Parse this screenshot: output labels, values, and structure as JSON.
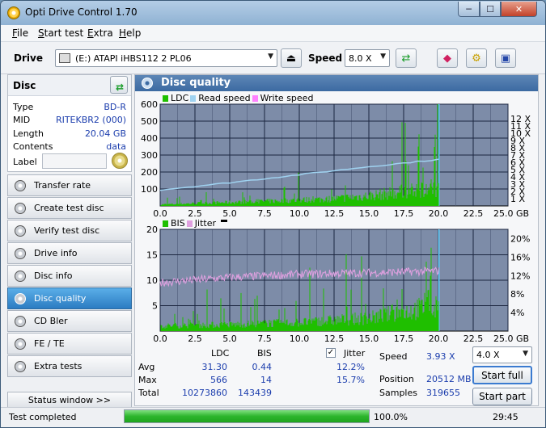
{
  "window": {
    "title": "Opti Drive Control 1.70",
    "min": "─",
    "max": "☐",
    "close": "✕"
  },
  "menu": [
    {
      "key": "F",
      "rest": "ile"
    },
    {
      "key": "S",
      "rest": "tart test"
    },
    {
      "key": "E",
      "rest": "xtra"
    },
    {
      "key": "H",
      "rest": "elp"
    }
  ],
  "toolbar": {
    "drive_label": "Drive",
    "drive_value": "(E:)   ATAPI iHBS112   2 PL06",
    "speed_label": "Speed",
    "speed_value": "8.0 X"
  },
  "disc": {
    "header": "Disc",
    "rows": [
      {
        "label": "Type",
        "value": "BD-R"
      },
      {
        "label": "MID",
        "value": "RITEKBR2 (000)"
      },
      {
        "label": "Length",
        "value": "20.04 GB"
      },
      {
        "label": "Contents",
        "value": "data"
      }
    ],
    "label_field": "Label"
  },
  "nav": [
    {
      "label": "Transfer rate",
      "active": false
    },
    {
      "label": "Create test disc",
      "active": false
    },
    {
      "label": "Verify test disc",
      "active": false
    },
    {
      "label": "Drive info",
      "active": false
    },
    {
      "label": "Disc info",
      "active": false
    },
    {
      "label": "Disc quality",
      "active": true
    },
    {
      "label": "CD Bler",
      "active": false
    },
    {
      "label": "FE / TE",
      "active": false
    },
    {
      "label": "Extra tests",
      "active": false
    }
  ],
  "status_window": "Status window >>",
  "panel_title": "Disc quality",
  "chart_data": [
    {
      "type": "area",
      "legend": [
        "LDC",
        "Read speed",
        "Write speed"
      ],
      "x_ticks": [
        "0.0",
        "2.5",
        "5.0",
        "7.5",
        "10.0",
        "12.5",
        "15.0",
        "17.5",
        "20.0",
        "22.5",
        "25.0 GB"
      ],
      "y_left_ticks": [
        "600",
        "500",
        "400",
        "300",
        "200",
        "100"
      ],
      "y_right_ticks": [
        "12 X",
        "11 X",
        "10 X",
        "9 X",
        "8 X",
        "7 X",
        "6 X",
        "5 X",
        "4 X",
        "3 X",
        "2 X",
        "1 X"
      ],
      "xlim": [
        0,
        25
      ],
      "ylim": [
        0,
        600
      ],
      "data_end": 20.04,
      "ldc_envelope": {
        "x": [
          0,
          2.5,
          5,
          7.5,
          10,
          12.5,
          15,
          17.5,
          20
        ],
        "y": [
          10,
          18,
          25,
          32,
          40,
          50,
          70,
          100,
          130
        ]
      },
      "read_speed": {
        "x": [
          0,
          5,
          10,
          15,
          20
        ],
        "y": [
          2.2,
          3.2,
          4.3,
          5.4,
          6.4
        ]
      }
    },
    {
      "type": "area",
      "legend": [
        "BIS",
        "Jitter"
      ],
      "x_ticks": [
        "0.0",
        "2.5",
        "5.0",
        "7.5",
        "10.0",
        "12.5",
        "15.0",
        "17.5",
        "20.0",
        "22.5",
        "25.0 GB"
      ],
      "y_left_ticks": [
        "20",
        "15",
        "10",
        "5"
      ],
      "y_right_ticks": [
        "20%",
        "16%",
        "12%",
        "8%",
        "4%"
      ],
      "xlim": [
        0,
        25
      ],
      "ylim": [
        0,
        20
      ],
      "data_end": 20.04,
      "jitter": {
        "x": [
          0,
          5,
          10,
          15,
          20
        ],
        "y": [
          10.5,
          11.6,
          12.3,
          12.6,
          13.0
        ]
      }
    }
  ],
  "stats": {
    "col_ldc": "LDC",
    "col_bis": "BIS",
    "col_jitter": "Jitter",
    "rows": [
      {
        "label": "Avg",
        "ldc": "31.30",
        "bis": "0.44",
        "jitter": "12.2%"
      },
      {
        "label": "Max",
        "ldc": "566",
        "bis": "14",
        "jitter": "15.7%"
      },
      {
        "label": "Total",
        "ldc": "10273860",
        "bis": "143439",
        "jitter": ""
      }
    ],
    "speed_label": "Speed",
    "speed_value": "3.93 X",
    "position_label": "Position",
    "position_value": "20512 MB",
    "samples_label": "Samples",
    "samples_value": "319655",
    "speed_select": "4.0 X",
    "start_full": "Start full",
    "start_part": "Start part"
  },
  "statusbar": {
    "text": "Test completed",
    "progress": "100.0%",
    "progress_fraction": 1.0,
    "time": "29:45"
  },
  "colors": {
    "ldc": "#1fbf00",
    "read": "#9fd2f0",
    "write": "#ff80ff",
    "bis": "#1fbf00",
    "jitter": "#e0a0e0",
    "plot_bg": "#7d8ca8",
    "grid": "#1c2640"
  }
}
